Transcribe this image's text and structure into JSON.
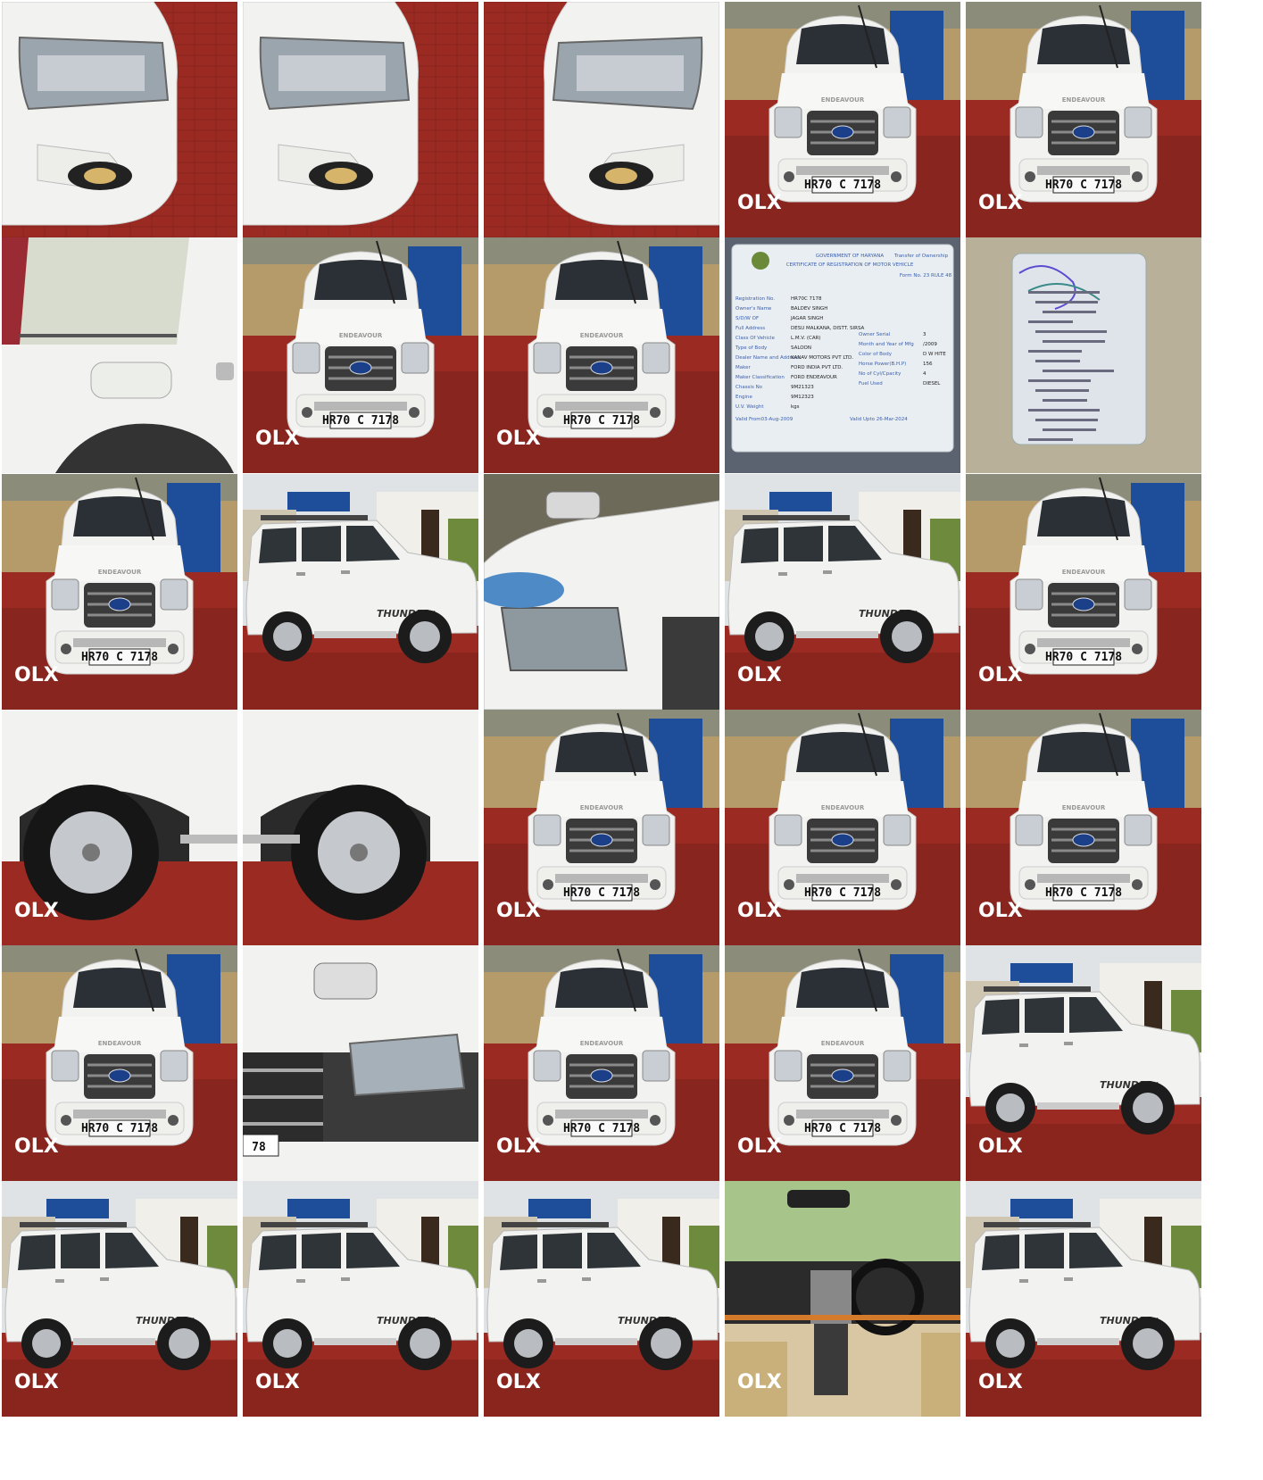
{
  "grid": {
    "columns": 5,
    "rows": 6,
    "tiles": [
      {
        "kind": "headlight-left",
        "plate": "",
        "badge": false
      },
      {
        "kind": "headlight-left",
        "plate": "",
        "badge": false
      },
      {
        "kind": "headlight-right",
        "plate": "",
        "badge": false
      },
      {
        "kind": "front",
        "plate": "HR70 C 7178",
        "badge": true
      },
      {
        "kind": "front",
        "plate": "HR70 C 7178",
        "badge": true
      },
      {
        "kind": "fuel-door",
        "plate": "",
        "badge": false
      },
      {
        "kind": "front",
        "plate": "HR70 C 7178",
        "badge": true
      },
      {
        "kind": "front",
        "plate": "HR70 C 7178",
        "badge": true
      },
      {
        "kind": "document",
        "plate": "",
        "badge": false
      },
      {
        "kind": "document-back",
        "plate": "",
        "badge": false
      },
      {
        "kind": "front",
        "plate": "HR70 C 7178",
        "badge": true
      },
      {
        "kind": "side",
        "plate": "",
        "badge": false
      },
      {
        "kind": "hood-closeup",
        "plate": "",
        "badge": false
      },
      {
        "kind": "side",
        "plate": "",
        "badge": true
      },
      {
        "kind": "front",
        "plate": "HR70 C 7178",
        "badge": true
      },
      {
        "kind": "wheel-rear",
        "plate": "",
        "badge": true
      },
      {
        "kind": "wheel-front",
        "plate": "",
        "badge": false
      },
      {
        "kind": "front",
        "plate": "HR70 C 7178",
        "badge": true
      },
      {
        "kind": "front",
        "plate": "HR70 C 7178",
        "badge": true
      },
      {
        "kind": "front",
        "plate": "HR70 C 7178",
        "badge": true
      },
      {
        "kind": "front",
        "plate": "HR70 C 7178",
        "badge": true
      },
      {
        "kind": "grille-closeup",
        "plate": "78",
        "badge": false
      },
      {
        "kind": "front",
        "plate": "HR70 C 7178",
        "badge": true
      },
      {
        "kind": "front",
        "plate": "HR70 C 7178",
        "badge": true
      },
      {
        "kind": "side",
        "plate": "",
        "badge": true
      },
      {
        "kind": "side",
        "plate": "",
        "badge": true
      },
      {
        "kind": "side",
        "plate": "",
        "badge": true
      },
      {
        "kind": "side",
        "plate": "",
        "badge": true
      },
      {
        "kind": "interior",
        "plate": "",
        "badge": true
      },
      {
        "kind": "side",
        "plate": "",
        "badge": true
      }
    ]
  },
  "badge_text": "OLX",
  "grille_lettering": "ENDEAVOUR",
  "side_decal": "THUNDER+",
  "document": {
    "header": "GOVERNMENT OF HARYANA",
    "subheader": "CERTIFICATE OF REGISTRATION OF MOTOR VEHICLE",
    "transfer": "Transfer of Ownership",
    "form": "Form No. 23 RULE 48",
    "fields": [
      {
        "label": "Registration No.",
        "value": "HR70C 7178"
      },
      {
        "label": "Owner's Name",
        "value": "BALDEV SINGH"
      },
      {
        "label": "S/D/W OF",
        "value": "JAGAR SINGH"
      },
      {
        "label": "Full Address",
        "value": "DESU MALKANA, DISTT. SIRSA"
      },
      {
        "label": "Class Of Vehicle",
        "value": "L.M.V. (CAR)"
      },
      {
        "label": "Type of Body",
        "value": "SALOON"
      },
      {
        "label": "Dealer Name and Address",
        "value": "KANAV MOTORS PVT LTD."
      },
      {
        "label": "Maker",
        "value": "FORD INDIA PVT LTD."
      },
      {
        "label": "Maker Classification",
        "value": "FORD ENDEAVOUR"
      },
      {
        "label": "Chassis No",
        "value": "9M21323"
      },
      {
        "label": "Engine",
        "value": "9M12323"
      },
      {
        "label": "U.V. Weight",
        "value": "kgs"
      }
    ],
    "right_fields": [
      {
        "label": "Owner Serial",
        "value": "3"
      },
      {
        "label": "Month and Year of Mfg",
        "value": "/2009"
      },
      {
        "label": "Color of Body",
        "value": "D W HITE"
      },
      {
        "label": "Horse Power(B.H.P)",
        "value": "156"
      },
      {
        "label": "No of Cyl/Cpacity",
        "value": "4"
      },
      {
        "label": "Fuel Used",
        "value": "DIESEL"
      }
    ],
    "valid_from": "Valid From03-Aug-2009",
    "valid_upto": "Valid Upto 26-Mar-2024"
  },
  "colors": {
    "car_white": "#f2f2f0",
    "ground_red": "#9a2a22",
    "ground_shadow": "#6e1d18",
    "grille": "#3a3a3a",
    "sky": "#c9cfd6",
    "blue_wall": "#1e4e9a",
    "wall_tan": "#b59a6a"
  }
}
